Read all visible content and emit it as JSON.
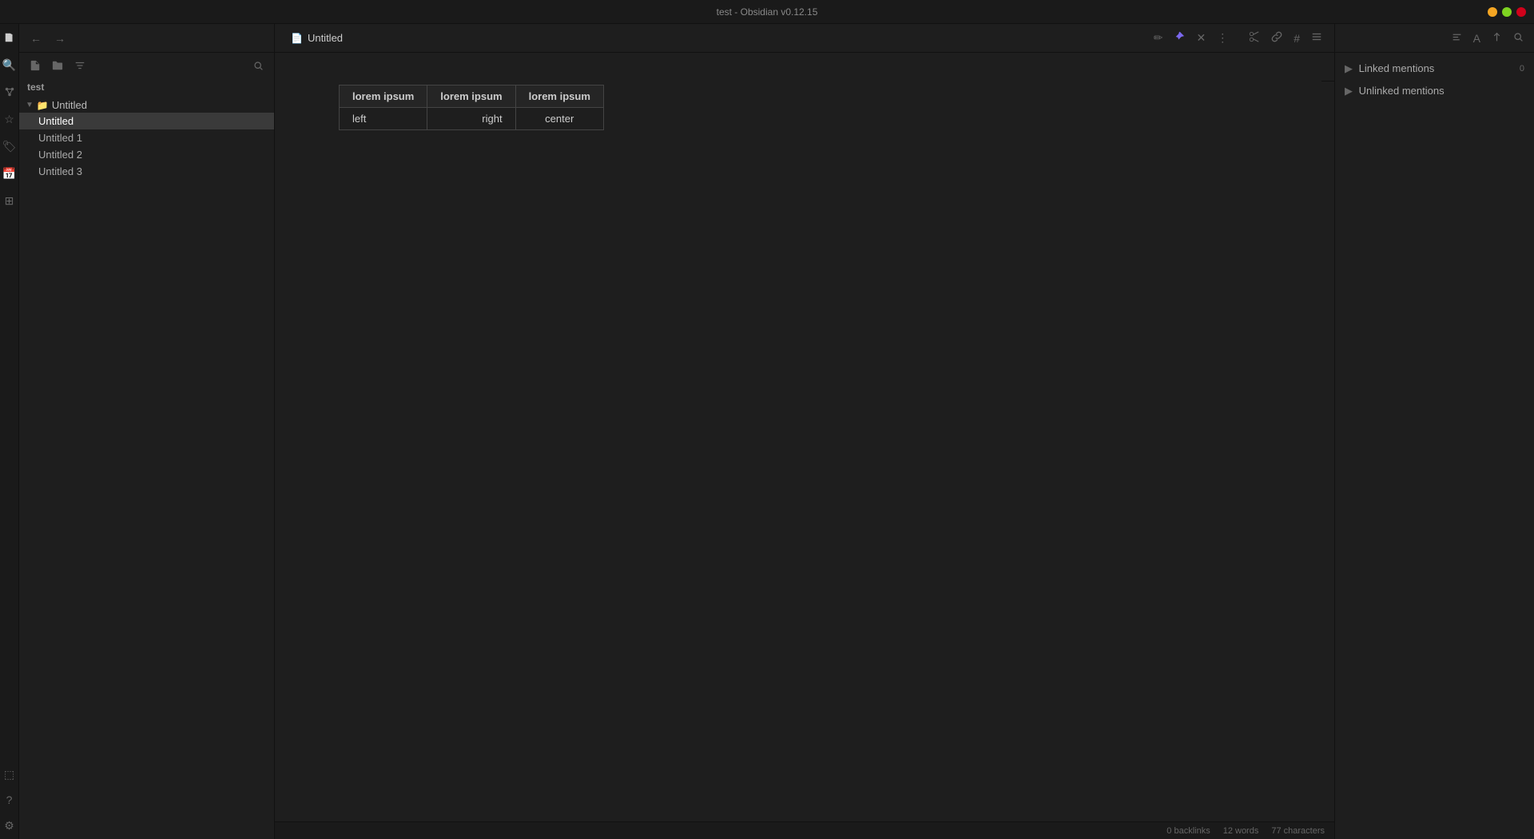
{
  "window": {
    "title": "test - Obsidian v0.12.15"
  },
  "sidebar": {
    "vault_name": "test",
    "new_file_tooltip": "New note",
    "new_folder_tooltip": "New folder",
    "sort_tooltip": "Sort",
    "search_tooltip": "Search",
    "folder": {
      "name": "Untitled",
      "expanded": true
    },
    "files": [
      {
        "name": "Untitled",
        "active": true
      },
      {
        "name": "Untitled 1",
        "active": false
      },
      {
        "name": "Untitled 2",
        "active": false
      },
      {
        "name": "Untitled 3",
        "active": false
      }
    ]
  },
  "editor": {
    "tab_title": "Untitled",
    "table": {
      "headers": [
        "lorem ipsum",
        "lorem ipsum",
        "lorem ipsum"
      ],
      "rows": [
        [
          "left",
          "right",
          "center"
        ]
      ]
    }
  },
  "toolbar": {
    "edit_icon": "✏",
    "pin_icon": "📌",
    "close_icon": "✕",
    "more_icon": "⋮",
    "scissors_icon": "✂",
    "link_icon": "🔗",
    "hash_icon": "#",
    "list_icon": "☰",
    "align_left_icon": "≡",
    "text_size_icon": "A",
    "sort_asc_icon": "↑",
    "search_icon": "🔍"
  },
  "right_panel": {
    "linked_mentions_label": "Linked mentions",
    "linked_mentions_count": "0",
    "unlinked_mentions_label": "Unlinked mentions"
  },
  "status_bar": {
    "backlinks": "0 backlinks",
    "words": "12 words",
    "characters": "77 characters"
  }
}
